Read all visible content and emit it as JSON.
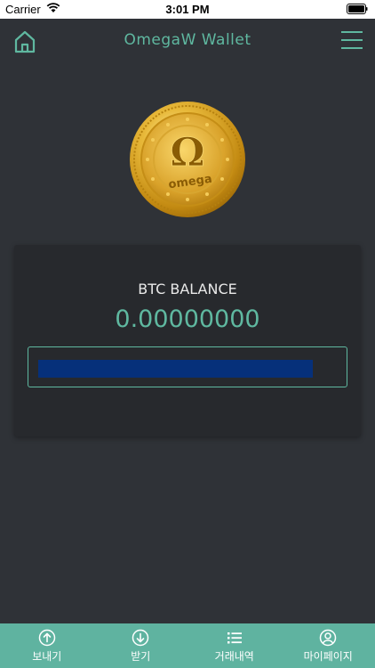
{
  "status": {
    "carrier": "Carrier",
    "time": "3:01 PM"
  },
  "header": {
    "title": "OmegaW Wallet",
    "home_icon": "home-icon",
    "menu_icon": "hamburger-menu-icon"
  },
  "coin": {
    "emblem_text": "Ω",
    "emblem_word": "omega"
  },
  "balance": {
    "label": "BTC BALANCE",
    "value": "0.00000000"
  },
  "tabs": [
    {
      "label": "보내기",
      "icon": "send-up-arrow-icon"
    },
    {
      "label": "받기",
      "icon": "receive-down-arrow-icon"
    },
    {
      "label": "거래내역",
      "icon": "list-icon"
    },
    {
      "label": "마이페이지",
      "icon": "user-profile-icon"
    }
  ],
  "colors": {
    "accent": "#5fb8a0",
    "background": "#2f3237",
    "card": "#27292d",
    "address_fill": "#06307a",
    "tab_bar": "#5fb3a0"
  }
}
